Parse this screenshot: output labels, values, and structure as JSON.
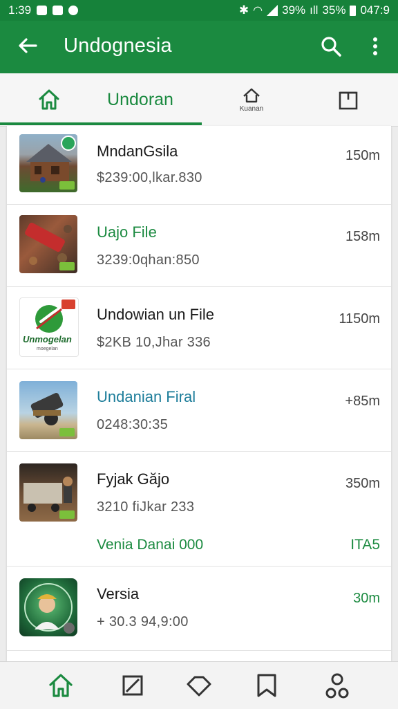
{
  "status_bar": {
    "time": "1:39",
    "battery_text_1": "39%",
    "battery_text_2": "35%",
    "right_time": "047:9"
  },
  "app_bar": {
    "title": "Undognesia",
    "icons": [
      "back-arrow-icon",
      "search-icon",
      "more-vert-icon"
    ]
  },
  "tabs": {
    "active_label": "Undoran",
    "small_label": "Kuanan",
    "icons": [
      "home-icon",
      "house-outline-icon",
      "box-icon"
    ]
  },
  "list": {
    "items": [
      {
        "name": "MndanGsila",
        "subtitle": "$239:00,lkar.830",
        "distance": "150m"
      },
      {
        "name": "Uajo File",
        "subtitle": "3239:0qhan:850",
        "distance": "158m"
      },
      {
        "name": "Undowian un File",
        "subtitle": "$2KB 10,Jhar 336",
        "distance": "1150m",
        "logo_text": "Unmogelan",
        "logo_sub": "moegelan"
      },
      {
        "name": "Undanian Firal",
        "subtitle": "0248:30:35",
        "distance": "+85m"
      },
      {
        "name": "Fyjak Găjo",
        "subtitle": "3210 fiJkar 233",
        "distance": "350m",
        "extra": "Venia Danai 000",
        "extra_right": "ITA5"
      },
      {
        "name": "Versia",
        "subtitle": "+ 30.3 94,9:00",
        "distance": "30m"
      }
    ]
  },
  "colors": {
    "primary": "#1b8a40",
    "status_bar": "#16823a",
    "accent_teal": "#1d7d9a"
  },
  "bottom_nav": {
    "icons": [
      "home-icon",
      "edit-square-icon",
      "tag-icon",
      "bookmark-icon",
      "profile-icon"
    ]
  }
}
